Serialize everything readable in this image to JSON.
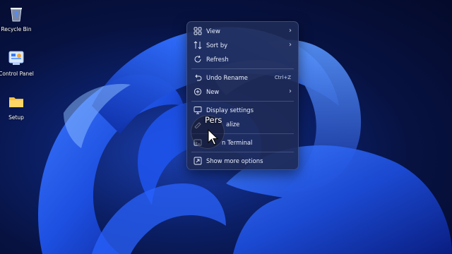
{
  "desktop": {
    "icons": [
      {
        "label": "Recycle Bin",
        "icon": "recycle-bin-icon"
      },
      {
        "label": "Control Panel",
        "icon": "control-panel-icon"
      },
      {
        "label": "Setup",
        "icon": "folder-icon"
      }
    ]
  },
  "context_menu": {
    "items": [
      {
        "label": "View",
        "icon": "grid-icon",
        "has_submenu": true
      },
      {
        "label": "Sort by",
        "icon": "sort-icon",
        "has_submenu": true
      },
      {
        "label": "Refresh",
        "icon": "refresh-icon"
      },
      {
        "label": "Undo Rename",
        "icon": "undo-icon",
        "shortcut": "Ctrl+Z"
      },
      {
        "label": "New",
        "icon": "plus-circle-icon",
        "has_submenu": true
      },
      {
        "label": "Display settings",
        "icon": "display-icon"
      },
      {
        "label": "alize",
        "icon": "personalize-icon"
      },
      {
        "label": "n Terminal",
        "icon": "terminal-icon"
      },
      {
        "label": "Show more options",
        "icon": "more-options-icon"
      }
    ],
    "chevron": "›"
  },
  "overlay": {
    "hover_text": "Pers"
  },
  "colors": {
    "menu_bg": "#1e2a56",
    "menu_text": "#e9eefc",
    "wallpaper_dark": "#040a2a",
    "wallpaper_blue": "#1b3fae"
  }
}
